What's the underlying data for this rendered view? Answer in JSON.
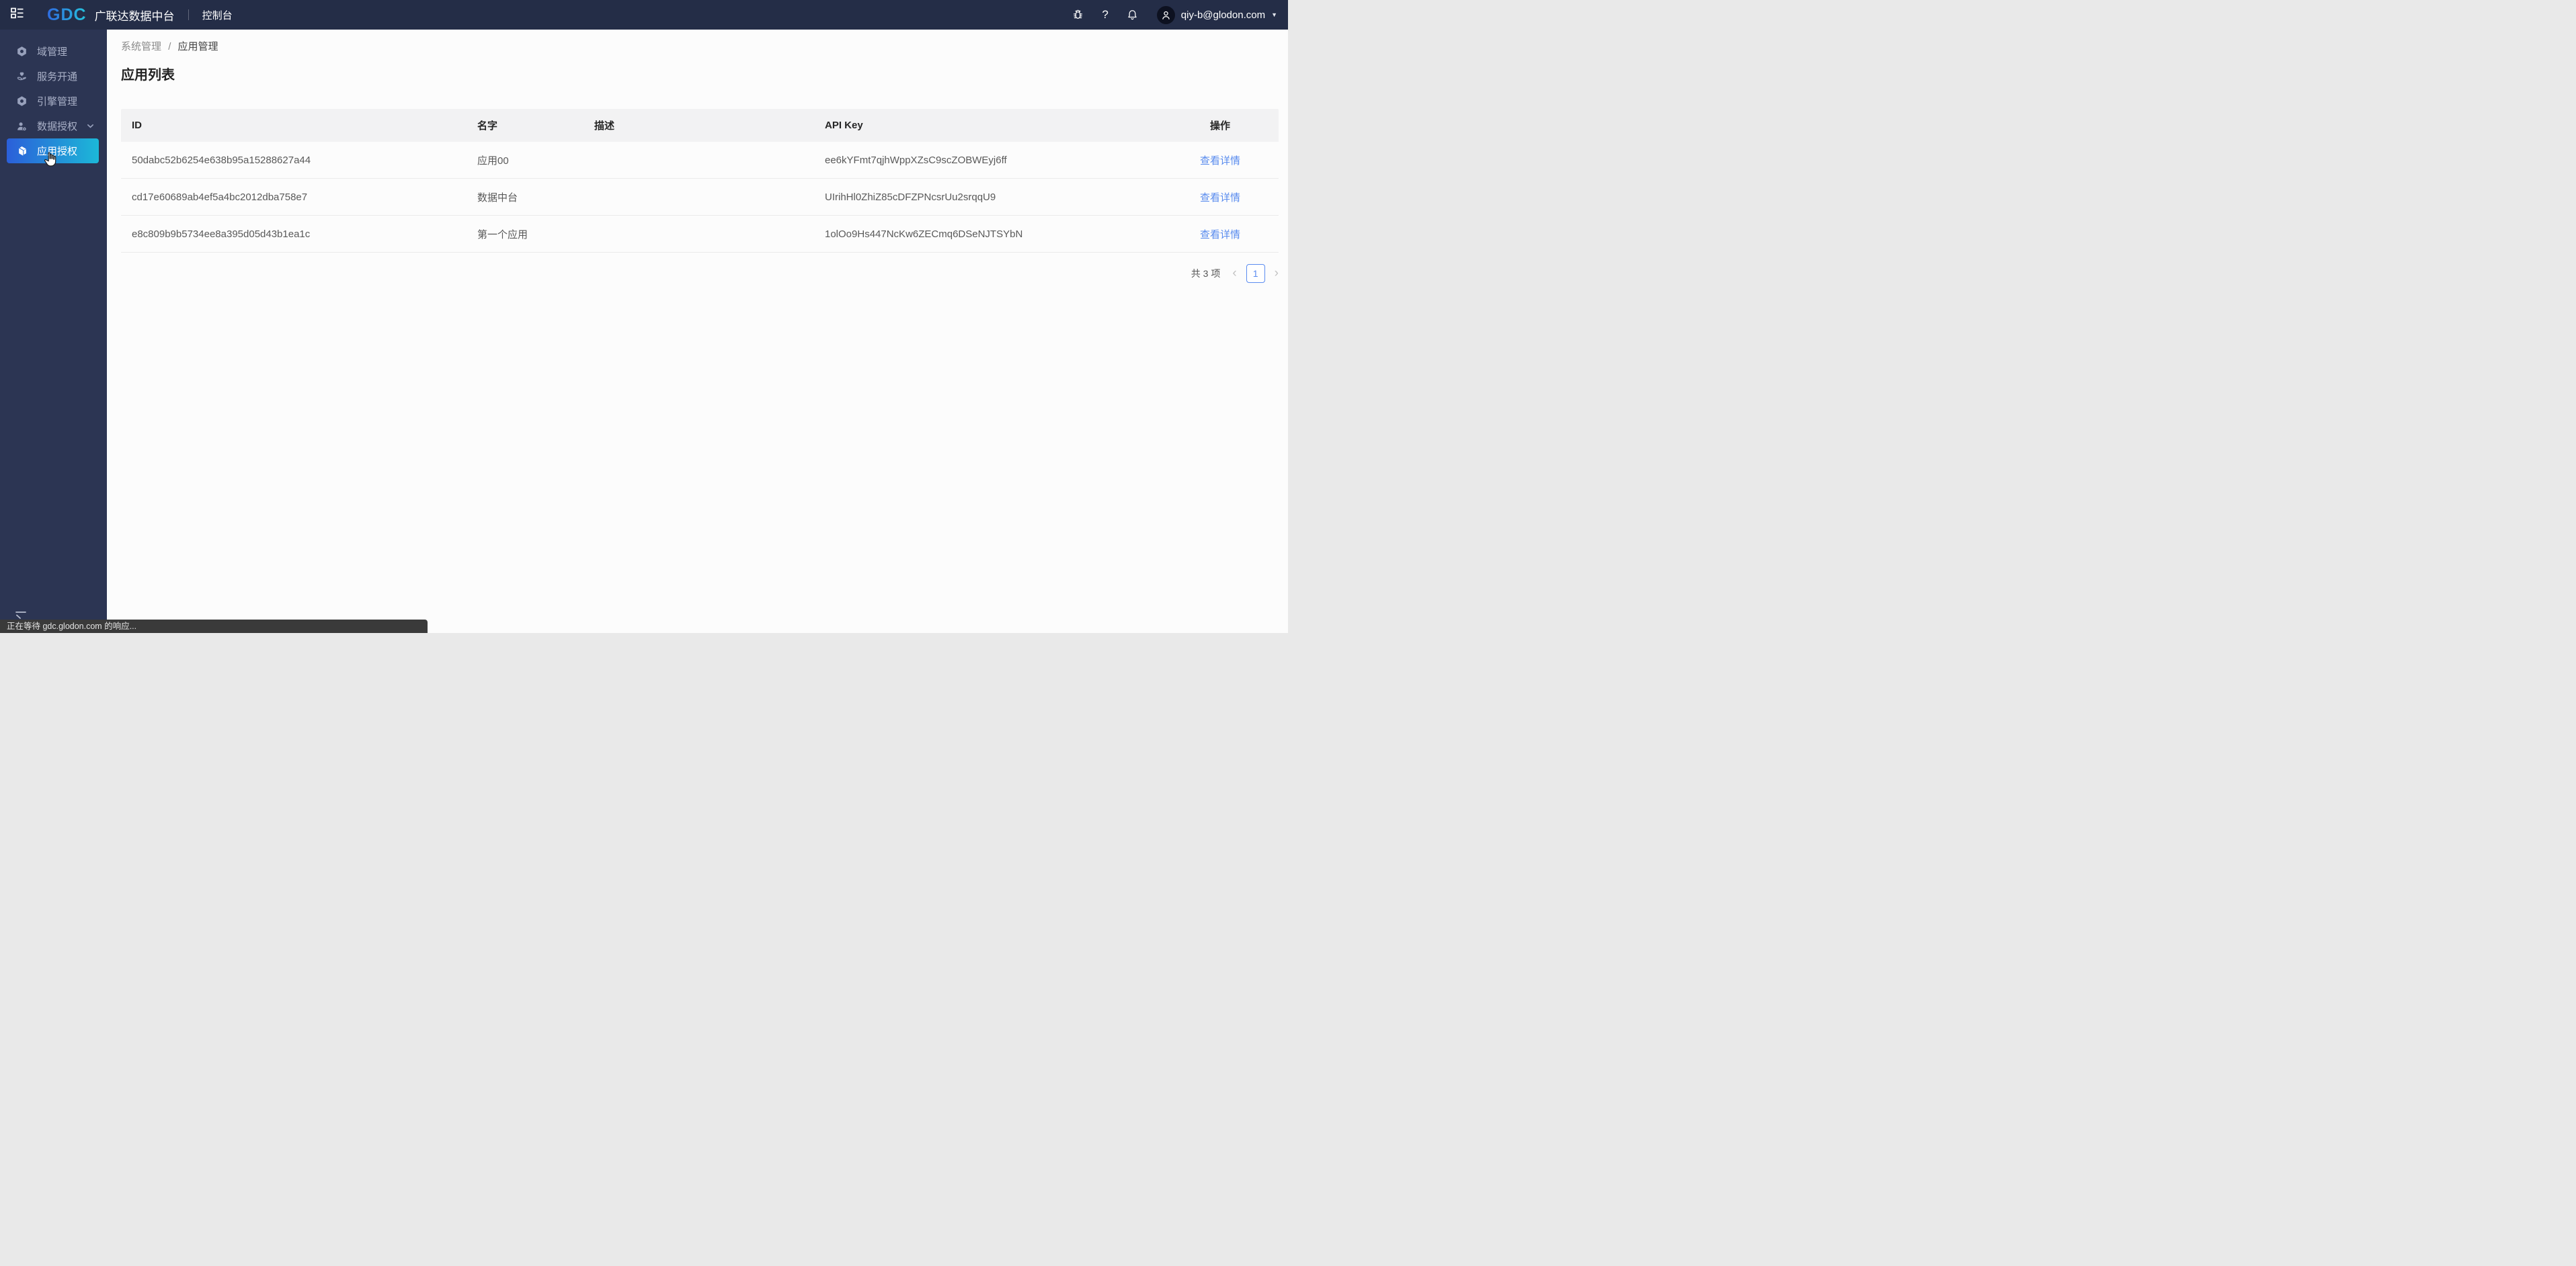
{
  "topbar": {
    "brand": "GDC",
    "brand_title": "广联达数据中台",
    "console_label": "控制台",
    "user_email": "qiy-b@glodon.com",
    "help_glyph": "?",
    "caret_glyph": "▼"
  },
  "sidebar": {
    "items": [
      {
        "label": "域管理",
        "icon": "hexagon-nut-icon",
        "active": false
      },
      {
        "label": "服务开通",
        "icon": "heart-hand-icon",
        "active": false
      },
      {
        "label": "引擎管理",
        "icon": "hexagon-nut-icon",
        "active": false
      },
      {
        "label": "数据授权",
        "icon": "user-gear-icon",
        "active": false,
        "has_children": true
      },
      {
        "label": "应用授权",
        "icon": "cube-icon",
        "active": true
      }
    ]
  },
  "breadcrumb": {
    "parent": "系统管理",
    "separator": "/",
    "current": "应用管理"
  },
  "page": {
    "title": "应用列表"
  },
  "table": {
    "columns": [
      "ID",
      "名字",
      "描述",
      "API Key",
      "操作"
    ],
    "rows": [
      {
        "id": "50dabc52b6254e638b95a15288627a44",
        "name": "应用00",
        "description": "",
        "api_key": "ee6kYFmt7qjhWppXZsC9scZOBWEyj6ff",
        "action": "查看详情"
      },
      {
        "id": "cd17e60689ab4ef5a4bc2012dba758e7",
        "name": "数据中台",
        "description": "",
        "api_key": "UIrihHl0ZhiZ85cDFZPNcsrUu2srqqU9",
        "action": "查看详情"
      },
      {
        "id": "e8c809b9b5734ee8a395d05d43b1ea1c",
        "name": "第一个应用",
        "description": "",
        "api_key": "1olOo9Hs447NcKw6ZECmq6DSeNJTSYbN",
        "action": "查看详情"
      }
    ]
  },
  "pagination": {
    "total_text": "共 3 项",
    "prev": "‹",
    "current_page": "1",
    "next": "›"
  },
  "statusbar": {
    "text": "正在等待 gdc.glodon.com 的响应..."
  },
  "colors": {
    "topbar_bg": "#242d47",
    "sidebar_bg": "#2c3553",
    "active_gradient_start": "#2b5fd9",
    "active_gradient_end": "#1cb8d8",
    "brand_gradient_start": "#2f6be0",
    "brand_gradient_end": "#25c3dc",
    "link": "#588bee",
    "header_bg": "#f2f2f3",
    "statusbar_bg": "#3a3a3a"
  }
}
